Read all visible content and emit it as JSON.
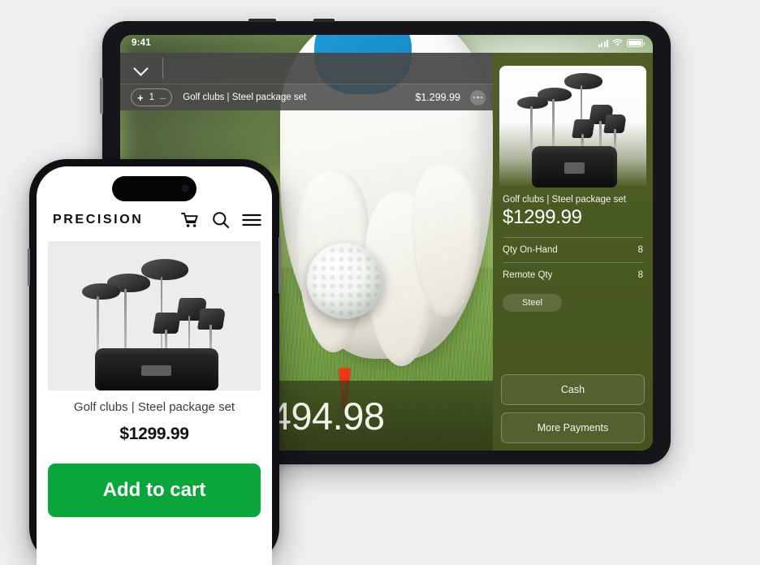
{
  "page": {
    "background_color": "#f0f0f0"
  },
  "tablet": {
    "status_bar": {
      "clock": "9:41",
      "signal_icon": "cellular-signal-icon",
      "wifi_icon": "wifi-icon",
      "battery_icon": "battery-icon"
    },
    "toolbar": {
      "collapse_icon": "chevron-down-icon",
      "search_icon": "search-icon",
      "add_icon": "plus-circle-icon",
      "more_icon": "more-horizontal-icon"
    },
    "cart_row": {
      "increment_label": "+",
      "quantity": "1",
      "decrement_label": "–",
      "item_name": "Golf clubs | Steel package set",
      "item_price": "$1.299.99",
      "row_more_icon": "more-horizontal-icon"
    },
    "total": {
      "amount": "$1494.98"
    },
    "detail_panel": {
      "product_image_alt": "golf-club-set-photo",
      "title": "Golf clubs | Steel package set",
      "price": "$1299.99",
      "specs": [
        {
          "label": "Qty On-Hand",
          "value": "8"
        },
        {
          "label": "Remote Qty",
          "value": "8"
        }
      ],
      "tag": "Steel",
      "buttons": [
        {
          "label": "Cash"
        },
        {
          "label": "More Payments"
        }
      ]
    },
    "colors": {
      "panel_green": "#4a5a23",
      "toolbar_gray": "#484848"
    }
  },
  "phone": {
    "brand": "PRECISION",
    "icons": {
      "cart": "shopping-cart-icon",
      "search": "search-icon",
      "menu": "hamburger-menu-icon"
    },
    "product": {
      "image_alt": "golf-club-set-photo",
      "title": "Golf clubs | Steel package set",
      "price": "$1299.99"
    },
    "add_to_cart_label": "Add to cart",
    "colors": {
      "cta_green": "#0aa63c"
    }
  }
}
